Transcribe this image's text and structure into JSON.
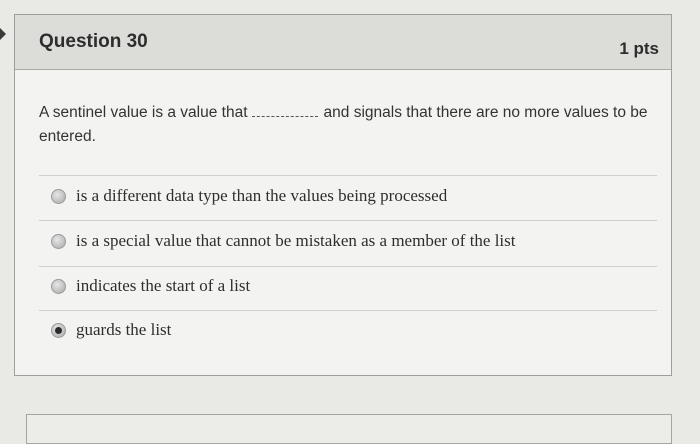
{
  "question": {
    "title": "Question 30",
    "points": "1 pts",
    "text_before_blank": "A sentinel value is a value that",
    "text_after_blank": "and signals that there are no more values to be",
    "text_line2": "entered."
  },
  "answers": [
    {
      "label": "is a different data type than the values being processed",
      "selected": false
    },
    {
      "label": "is a special value that cannot be mistaken as a member of the list",
      "selected": false
    },
    {
      "label": "indicates the start of a list",
      "selected": false
    },
    {
      "label": "guards the list",
      "selected": true
    }
  ]
}
